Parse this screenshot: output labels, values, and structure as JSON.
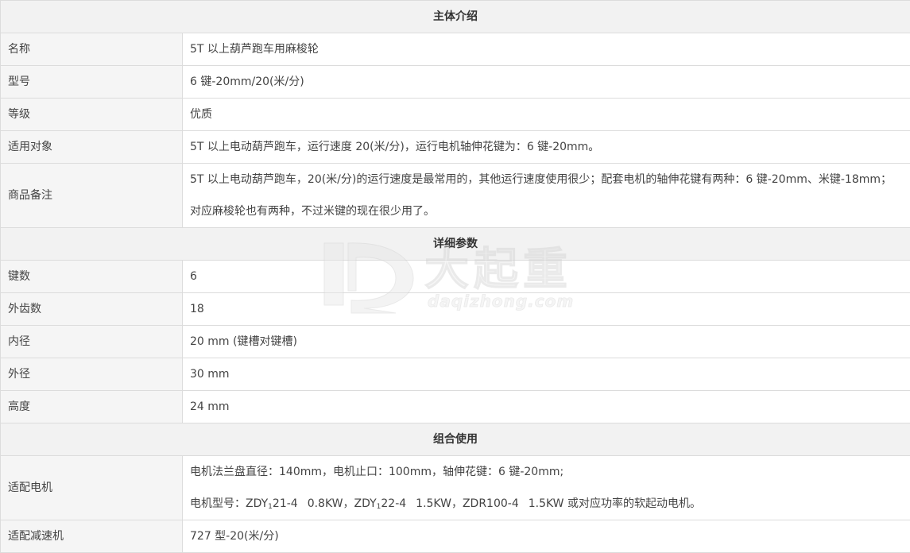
{
  "sections": {
    "intro": "主体介绍",
    "detail": "详细参数",
    "combo": "组合使用"
  },
  "rows": {
    "name": {
      "label": "名称",
      "value": "5T 以上葫芦跑车用麻梭轮"
    },
    "model": {
      "label": "型号",
      "value": "6 键-20mm/20(米/分)"
    },
    "grade": {
      "label": "等级",
      "value": "优质"
    },
    "target": {
      "label": "适用对象",
      "value": "5T 以上电动葫芦跑车，运行速度 20(米/分)，运行电机轴伸花键为：6 键-20mm。"
    },
    "remark": {
      "label": "商品备注",
      "line1": "5T 以上电动葫芦跑车，20(米/分)的运行速度是最常用的，其他运行速度使用很少；配套电机的轴伸花键有两种：6 键-20mm、米键-18mm；",
      "line2": "对应麻梭轮也有两种，不过米键的现在很少用了。"
    },
    "keys": {
      "label": "键数",
      "value": "6"
    },
    "teeth": {
      "label": "外齿数",
      "value": "18"
    },
    "inner": {
      "label": "内径",
      "value": "20 mm (键槽对键槽)"
    },
    "outer": {
      "label": "外径",
      "value": "30 mm"
    },
    "height": {
      "label": "高度",
      "value": "24 mm"
    },
    "motor": {
      "label": "适配电机",
      "line1": "电机法兰盘直径：140mm，电机止口：100mm，轴伸花键：6 键-20mm;",
      "m_prefix": "电机型号：ZDY",
      "m_sub1": "1",
      "m_part2": "21-4",
      "m_part3": "0.8KW，ZDY",
      "m_sub2": "1",
      "m_part4": "22-4",
      "m_part5": "1.5KW，ZDR100-4",
      "m_part6": "1.5KW 或对应功率的软起动电机。"
    },
    "reducer": {
      "label": "适配减速机",
      "value": "727 型-20(米/分)"
    }
  },
  "watermark": {
    "brand": "大起重",
    "domain": "daqizhong.com"
  }
}
